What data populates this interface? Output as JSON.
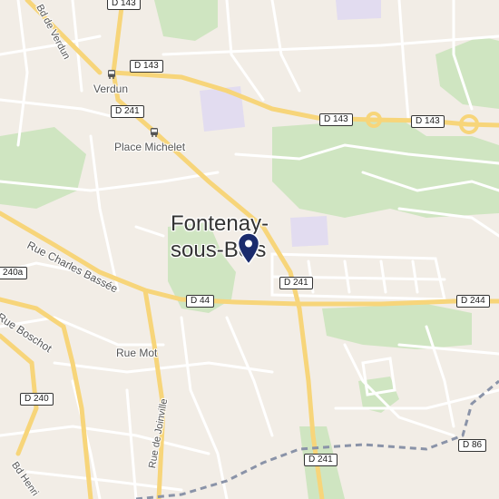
{
  "map": {
    "city": {
      "line1": "Fontenay-",
      "line2": "sous-Bois"
    },
    "route_shields": {
      "d143_a": "D 143",
      "d143_b": "D 143",
      "d143_c": "D 143",
      "d241_a": "D 241",
      "d241_b": "D 241",
      "d241_c": "D 241",
      "d44": "D 44",
      "d244": "D 244",
      "d240": "D 240",
      "d240a": "240a",
      "d86": "D 86"
    },
    "streets": {
      "bd_verdun": "Bd de Verdun",
      "rue_charles_bassee": "Rue Charles Bassée",
      "rue_boschot": "Rue Boschot",
      "rue_mot": "Rue Mot",
      "rue_joinville": "Rue de Joinville",
      "bd_henri": "Bd Henri"
    },
    "stations": {
      "verdun": "Verdun",
      "place_michelet": "Place Michelet"
    },
    "colors": {
      "background": "#f2ede6",
      "park": "#cfe5c1",
      "major_road": "#f7d57a",
      "minor_road": "#ffffff",
      "boundary": "#8a93a8",
      "pin": "#1a2b6d",
      "campus": "#e2dcf0"
    },
    "icons": {
      "station": "bus-stop-icon",
      "marker": "location-pin-icon"
    }
  }
}
